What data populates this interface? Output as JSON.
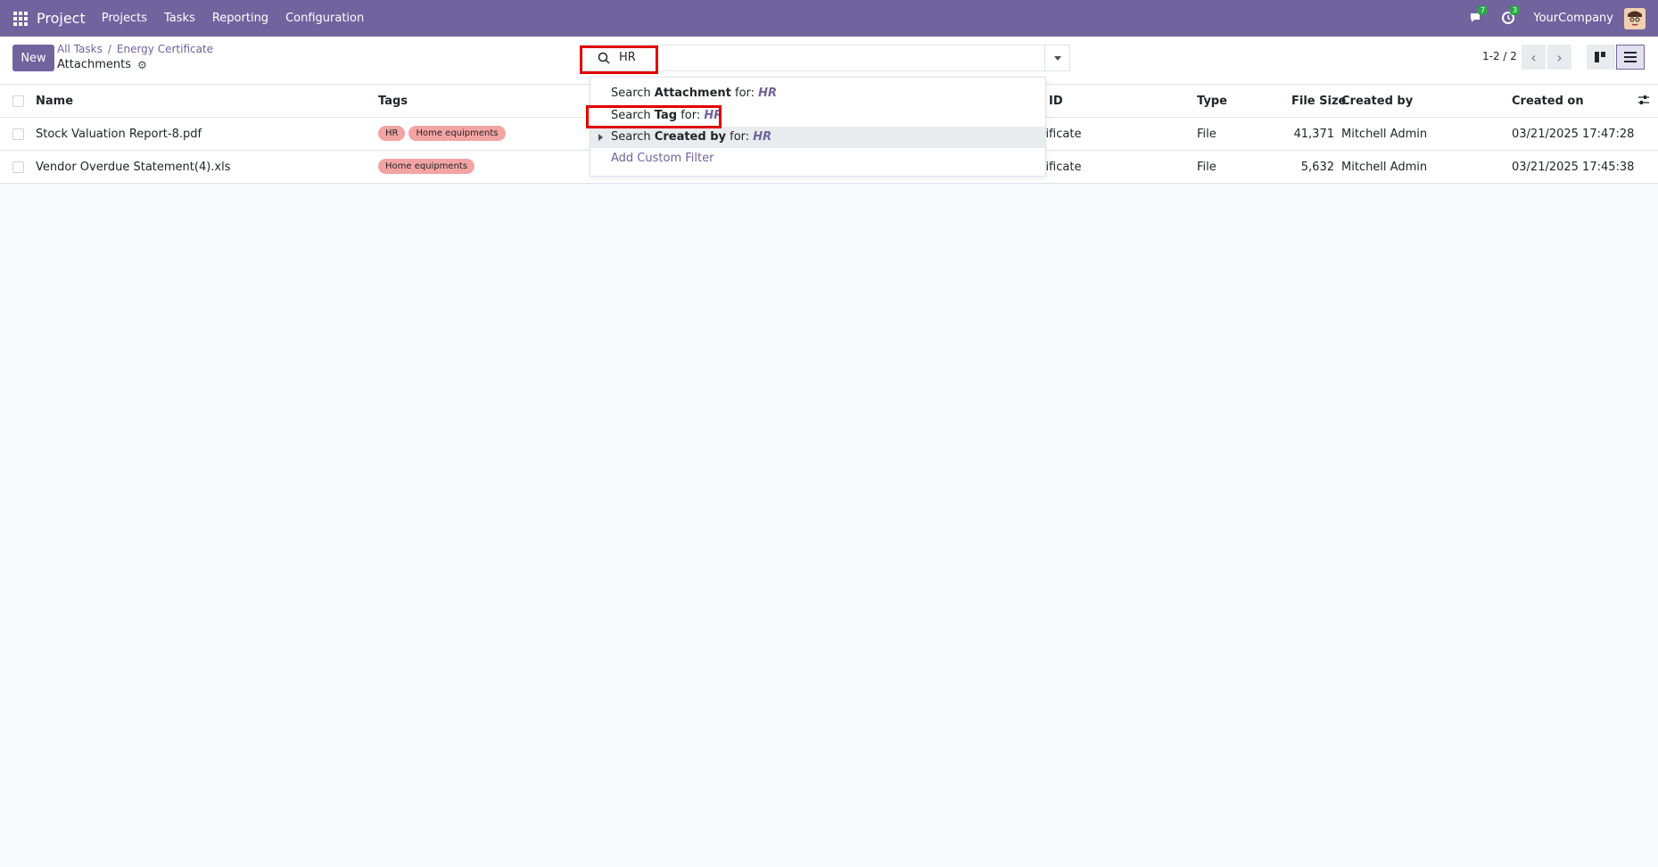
{
  "topbar": {
    "app_name": "Project",
    "menu": [
      "Projects",
      "Tasks",
      "Reporting",
      "Configuration"
    ],
    "messages_badge": "7",
    "activities_badge": "3",
    "company": "YourCompany",
    "icons": [
      "apps-icon",
      "chat-icon",
      "clock-icon",
      "avatar"
    ]
  },
  "control_panel": {
    "new_label": "New",
    "breadcrumb": [
      "All Tasks",
      "Energy Certificate"
    ],
    "title": "Attachments",
    "search_value": "HR",
    "pager": "1-2 / 2"
  },
  "table": {
    "headers": [
      "Name",
      "Tags",
      "ID",
      "Type",
      "File Size",
      "Created by",
      "Created on"
    ],
    "rows": [
      {
        "name": "Stock Valuation Report-8.pdf",
        "tags": [
          "HR",
          "Home equipments"
        ],
        "res": "rtificate",
        "type": "File",
        "size": "41,371",
        "created_by": "Mitchell Admin",
        "created_on": "03/21/2025 17:47:28"
      },
      {
        "name": "Vendor Overdue Statement(4).xls",
        "tags": [
          "Home equipments"
        ],
        "res": "rtificate",
        "type": "File",
        "size": "5,632",
        "created_by": "Mitchell Admin",
        "created_on": "03/21/2025 17:45:38"
      }
    ]
  },
  "dropdown": {
    "items": [
      {
        "prefix": "Search ",
        "field": "Attachment",
        "mid": " for: ",
        "query": "HR"
      },
      {
        "prefix": "Search ",
        "field": "Tag",
        "mid": " for: ",
        "query": "HR"
      },
      {
        "prefix": "Search ",
        "field": "Created by",
        "mid": " for: ",
        "query": "HR"
      }
    ],
    "custom_filter": "Add Custom Filter"
  },
  "colors": {
    "brand": "#71639e",
    "tag_bg": "#f4a3a3",
    "highlight": "#e00000",
    "badge": "#28a745"
  }
}
